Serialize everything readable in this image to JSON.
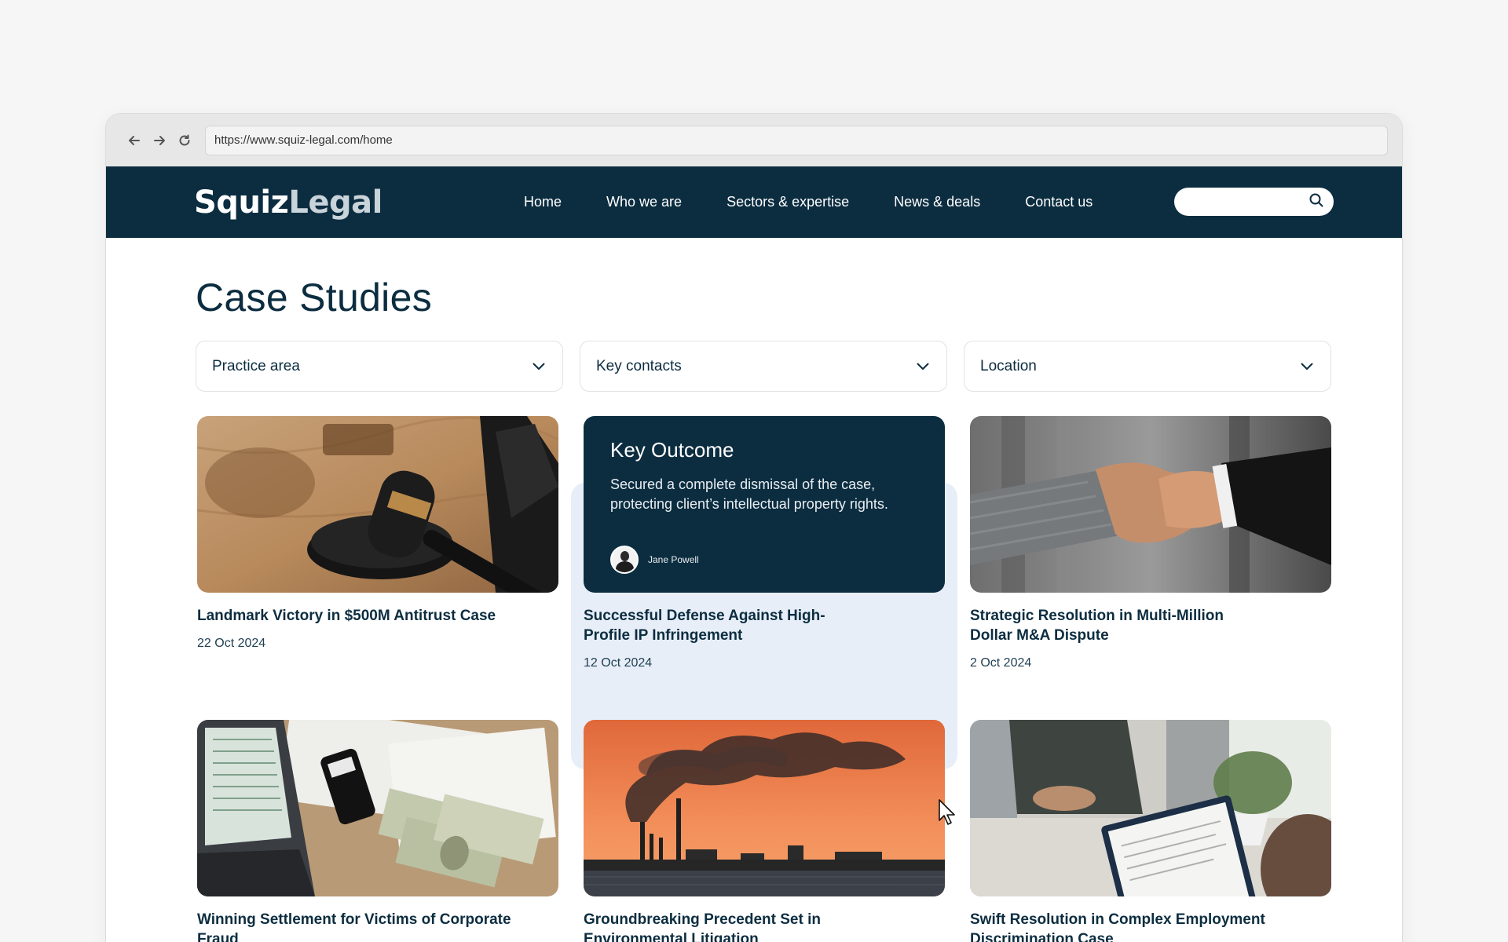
{
  "browser": {
    "url": "https://www.squiz-legal.com/home",
    "back_icon": "back-arrow-icon",
    "forward_icon": "forward-arrow-icon",
    "reload_icon": "reload-icon"
  },
  "header": {
    "logo_bold": "Squiz",
    "logo_light": "Legal",
    "nav": [
      "Home",
      "Who we are",
      "Sectors & expertise",
      "News & deals",
      "Contact us"
    ],
    "search_placeholder": "",
    "search_icon": "search-icon"
  },
  "main": {
    "title": "Case Studies",
    "filters": [
      {
        "label": "Practice area",
        "icon": "chevron-down-icon"
      },
      {
        "label": "Key contacts",
        "icon": "chevron-down-icon"
      },
      {
        "label": "Location",
        "icon": "chevron-down-icon"
      }
    ],
    "cards": [
      {
        "title": "Landmark Victory in $500M Antitrust Case",
        "date": "22 Oct 2024",
        "image": "gavel-photo"
      },
      {
        "title": "Successful Defense Against High-Profile IP Infringement",
        "date": "12 Oct 2024",
        "highlighted": true,
        "outcome": {
          "heading": "Key Outcome",
          "text": "Secured a complete dismissal of the case, protecting client’s intellectual property rights.",
          "person": "Jane Powell"
        }
      },
      {
        "title": "Strategic Resolution in Multi-Million Dollar M&A Dispute",
        "date": "2 Oct 2024",
        "image": "handshake-photo"
      },
      {
        "title": "Winning Settlement for Victims of Corporate Fraud",
        "date": "",
        "image": "money-laptop-photo"
      },
      {
        "title": "Groundbreaking Precedent Set in Environmental Litigation",
        "date": "",
        "image": "factory-smoke-photo"
      },
      {
        "title": "Swift Resolution in Complex Employment Discrimination Case",
        "date": "",
        "image": "interview-photo"
      }
    ]
  },
  "colors": {
    "brand_navy": "#0c2d40",
    "highlight_bg": "#e7eef7",
    "page_bg": "#f6f6f6"
  }
}
